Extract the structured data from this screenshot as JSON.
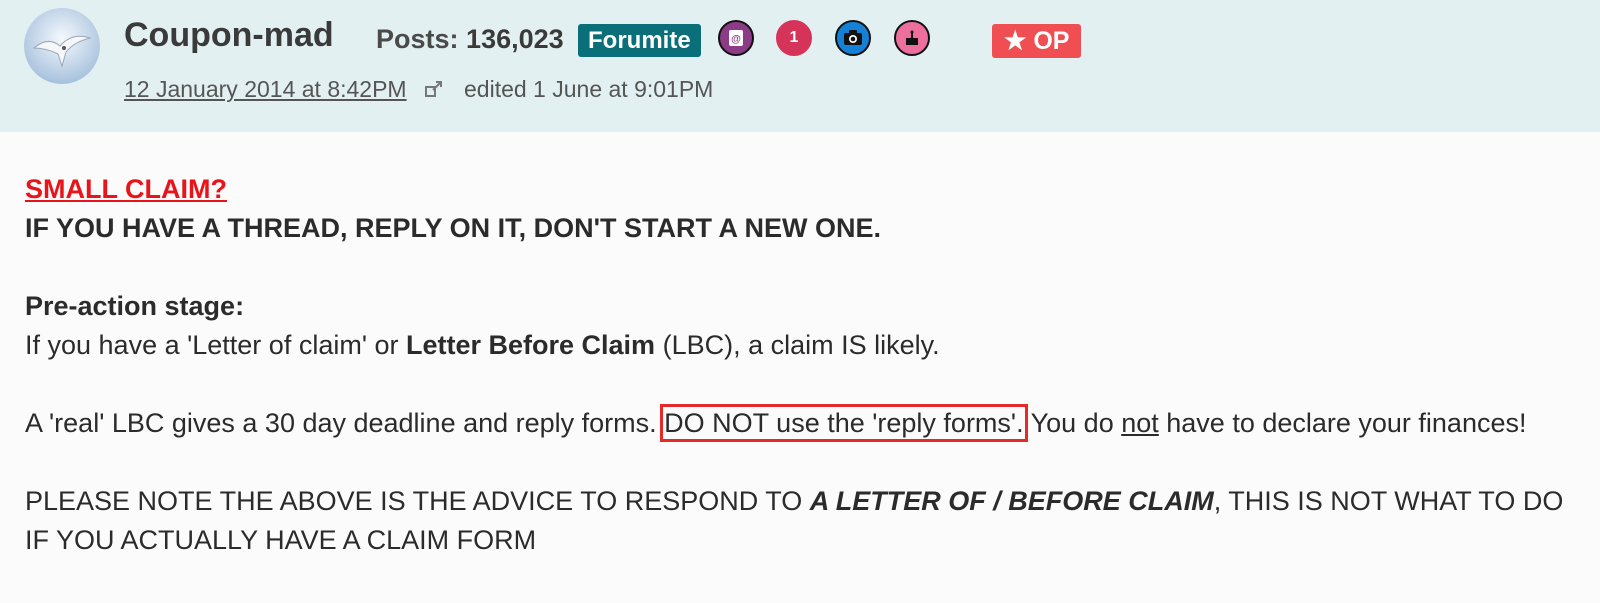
{
  "post": {
    "author": {
      "name": "Coupon-mad",
      "posts_label": "Posts:",
      "posts_count": "136,023",
      "rank": "Forumite",
      "op_label": "★ OP",
      "badges": [
        {
          "icon": "address-book-icon",
          "color": "#8c3b86",
          "text": "@"
        },
        {
          "icon": "number-one-badge-icon",
          "color": "#d6335b",
          "text": "1"
        },
        {
          "icon": "camera-icon",
          "color": "#1481d6",
          "text": ""
        },
        {
          "icon": "birthday-cake-icon",
          "color": "#ee6e9e",
          "text": ""
        }
      ]
    },
    "date": "12 January 2014 at 8:42PM",
    "edited": "edited 1 June at 9:01PM",
    "body": {
      "title": "SMALL CLAIM?",
      "notice": "IF YOU HAVE A THREAD, REPLY ON IT, DON'T START A NEW ONE.",
      "stage_heading": "Pre-action stage:",
      "p1_a": "If you have a 'Letter of claim' or ",
      "p1_b": "Letter Before Claim",
      "p1_c": " (LBC), a claim IS likely.",
      "p2_a": "A 'real' LBC gives a 30 day deadline and reply forms. ",
      "p2_boxed": "DO NOT use the 'reply forms'.",
      "p2_c": " You do ",
      "p2_not": "not",
      "p2_d": " have to declare your finances!",
      "p3_a": "PLEASE NOTE THE ABOVE IS THE ADVICE TO RESPOND TO ",
      "p3_b": "A LETTER OF / BEFORE CLAIM",
      "p3_c": ", THIS IS NOT WHAT TO DO IF YOU ACTUALLY HAVE A CLAIM FORM"
    }
  },
  "colors": {
    "header_bg": "#e3f0f2",
    "rank_bg": "#0b6f7a",
    "op_bg": "#ef4f52",
    "title_red": "#e8141a",
    "highlight_box": "#e52a2a"
  }
}
